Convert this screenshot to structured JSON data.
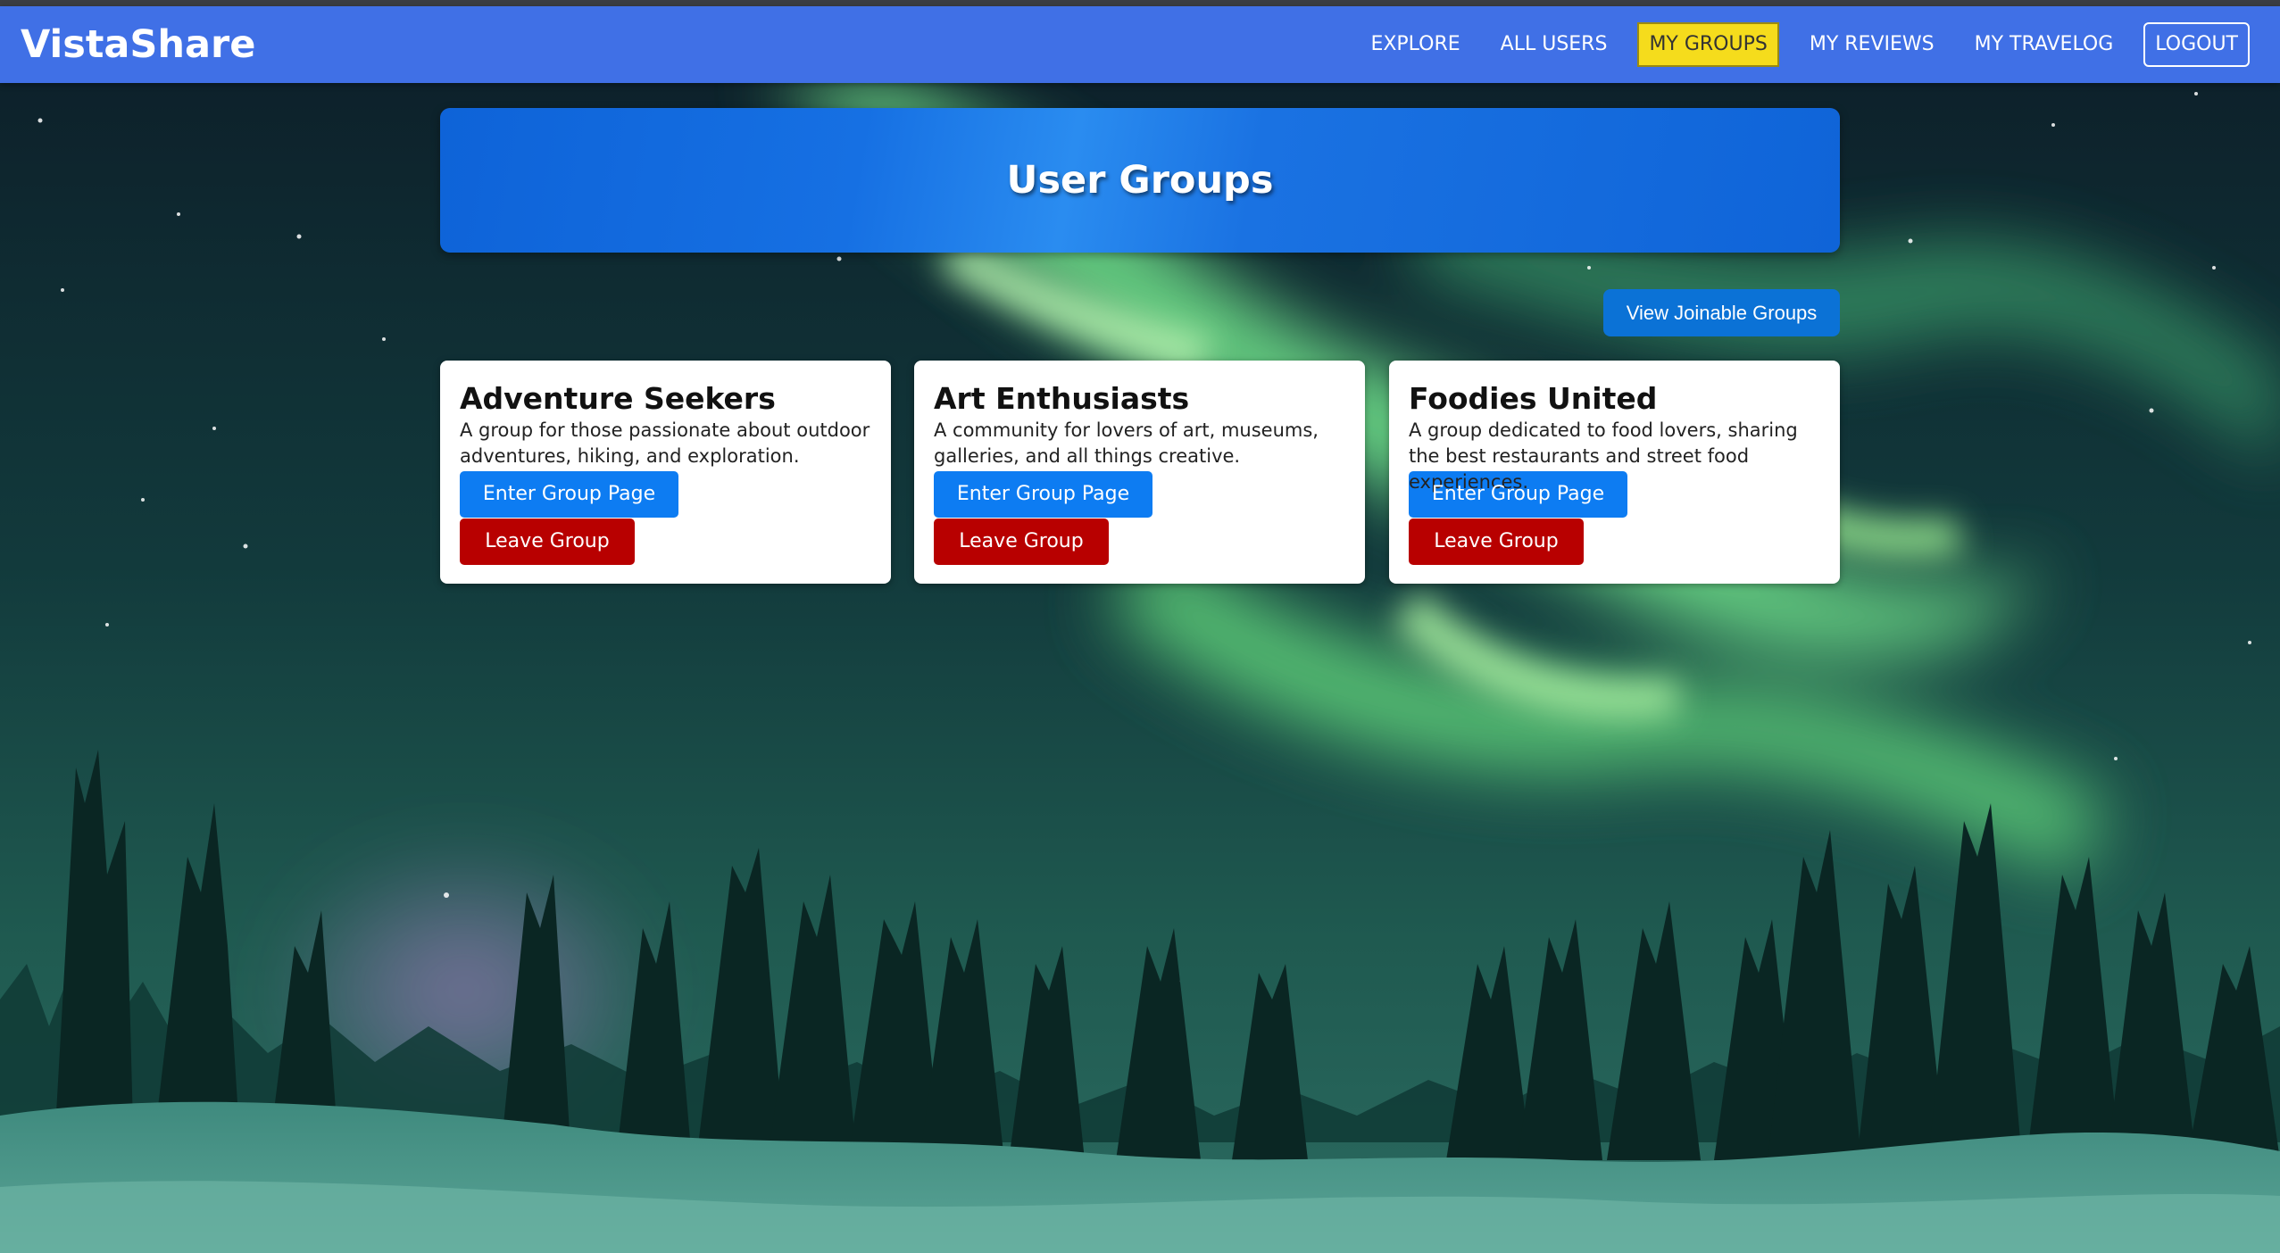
{
  "navbar": {
    "brand": "VistaShare",
    "links": [
      {
        "label": "EXPLORE"
      },
      {
        "label": "ALL USERS"
      },
      {
        "label": "MY GROUPS"
      },
      {
        "label": "MY REVIEWS"
      },
      {
        "label": "MY TRAVELOG"
      },
      {
        "label": "LOGOUT"
      }
    ],
    "active_link": "MY GROUPS"
  },
  "hero": {
    "title": "User Groups"
  },
  "actions": {
    "view_joinable": "View Joinable Groups"
  },
  "groups": [
    {
      "name": "Adventure Seekers",
      "description": "A group for those passionate about outdoor adventures, hiking, and exploration.",
      "enter_label": "Enter Group Page",
      "leave_label": "Leave Group"
    },
    {
      "name": "Art Enthusiasts",
      "description": "A community for lovers of art, museums, galleries, and all things creative.",
      "enter_label": "Enter Group Page",
      "leave_label": "Leave Group"
    },
    {
      "name": "Foodies United",
      "description": "A group dedicated to food lovers, sharing the best restaurants and street food experiences.",
      "enter_label": "Enter Group Page",
      "leave_label": "Leave Group"
    }
  ],
  "colors": {
    "navbar": "#4070e6",
    "active_tab": "#f5dc1c",
    "hero": "#1670e3",
    "enter_button": "#0d7cf2",
    "leave_button": "#b80000",
    "join_button": "#0b72d6"
  },
  "background": {
    "description_icon": "aurora-forest-background"
  }
}
